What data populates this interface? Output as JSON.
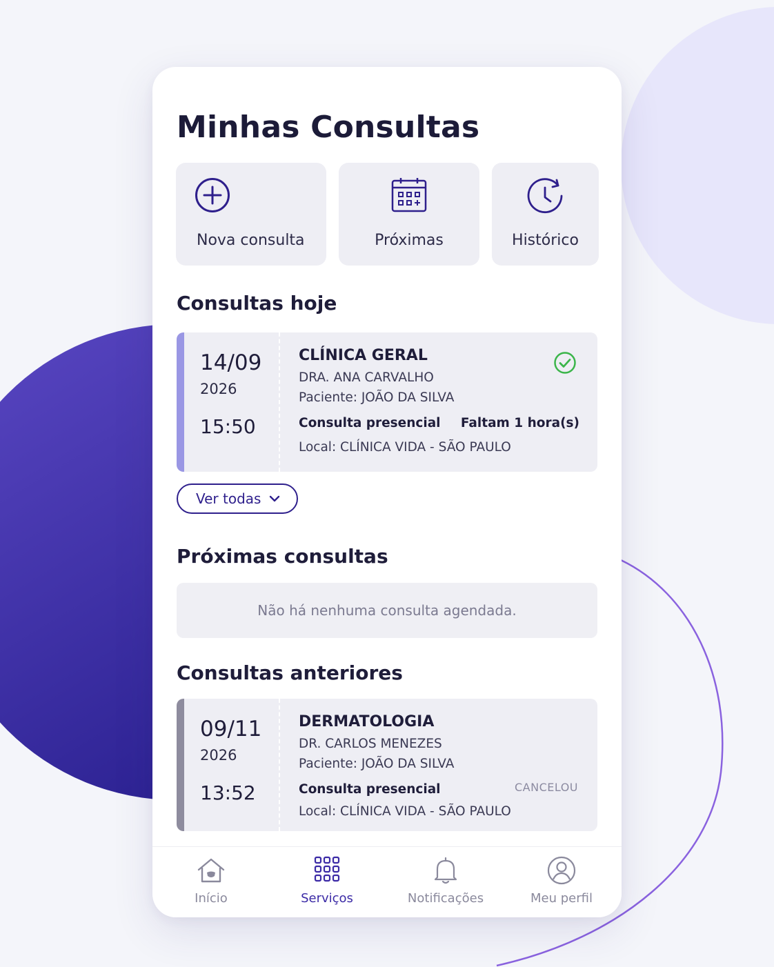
{
  "page": {
    "title": "Minhas Consultas"
  },
  "quick_actions": [
    {
      "label": "Nova consulta",
      "icon": "plus-circle-icon"
    },
    {
      "label": "Próximas",
      "icon": "calendar-icon"
    },
    {
      "label": "Histórico",
      "icon": "history-icon"
    }
  ],
  "today": {
    "title": "Consultas hoje",
    "appointment": {
      "date": "14/09",
      "year": "2026",
      "time": "15:50",
      "specialty": "CLÍNICA GERAL",
      "doctor": "DRA. ANA CARVALHO",
      "patient": "Paciente: JOÃO DA SILVA",
      "mode": "Consulta presencial",
      "remaining": "Faltam 1 hora(s)",
      "location": "Local: CLÍNICA VIDA - SÃO PAULO",
      "status_icon": "check-circle-icon"
    },
    "see_all_label": "Ver todas"
  },
  "upcoming": {
    "title": "Próximas consultas",
    "empty_message": "Não há nenhuma consulta agendada."
  },
  "past": {
    "title": "Consultas anteriores",
    "appointment": {
      "date": "09/11",
      "year": "2026",
      "time": "13:52",
      "specialty": "DERMATOLOGIA",
      "doctor": "DR. CARLOS MENEZES",
      "patient": "Paciente: JOÃO DA SILVA",
      "mode": "Consulta presencial",
      "status": "CANCELOU",
      "location": "Local: CLÍNICA VIDA - SÃO PAULO"
    }
  },
  "bottom_nav": [
    {
      "label": "Início",
      "icon": "home-icon",
      "active": false
    },
    {
      "label": "Serviços",
      "icon": "grid-icon",
      "active": true
    },
    {
      "label": "Notificações",
      "icon": "bell-icon",
      "active": false
    },
    {
      "label": "Meu perfil",
      "icon": "user-icon",
      "active": false
    }
  ],
  "colors": {
    "primary": "#2e1f8c",
    "accent_today": "#9a97e4",
    "accent_past": "#8e8c9e",
    "success": "#3bb54a",
    "background": "#f4f5fa"
  }
}
